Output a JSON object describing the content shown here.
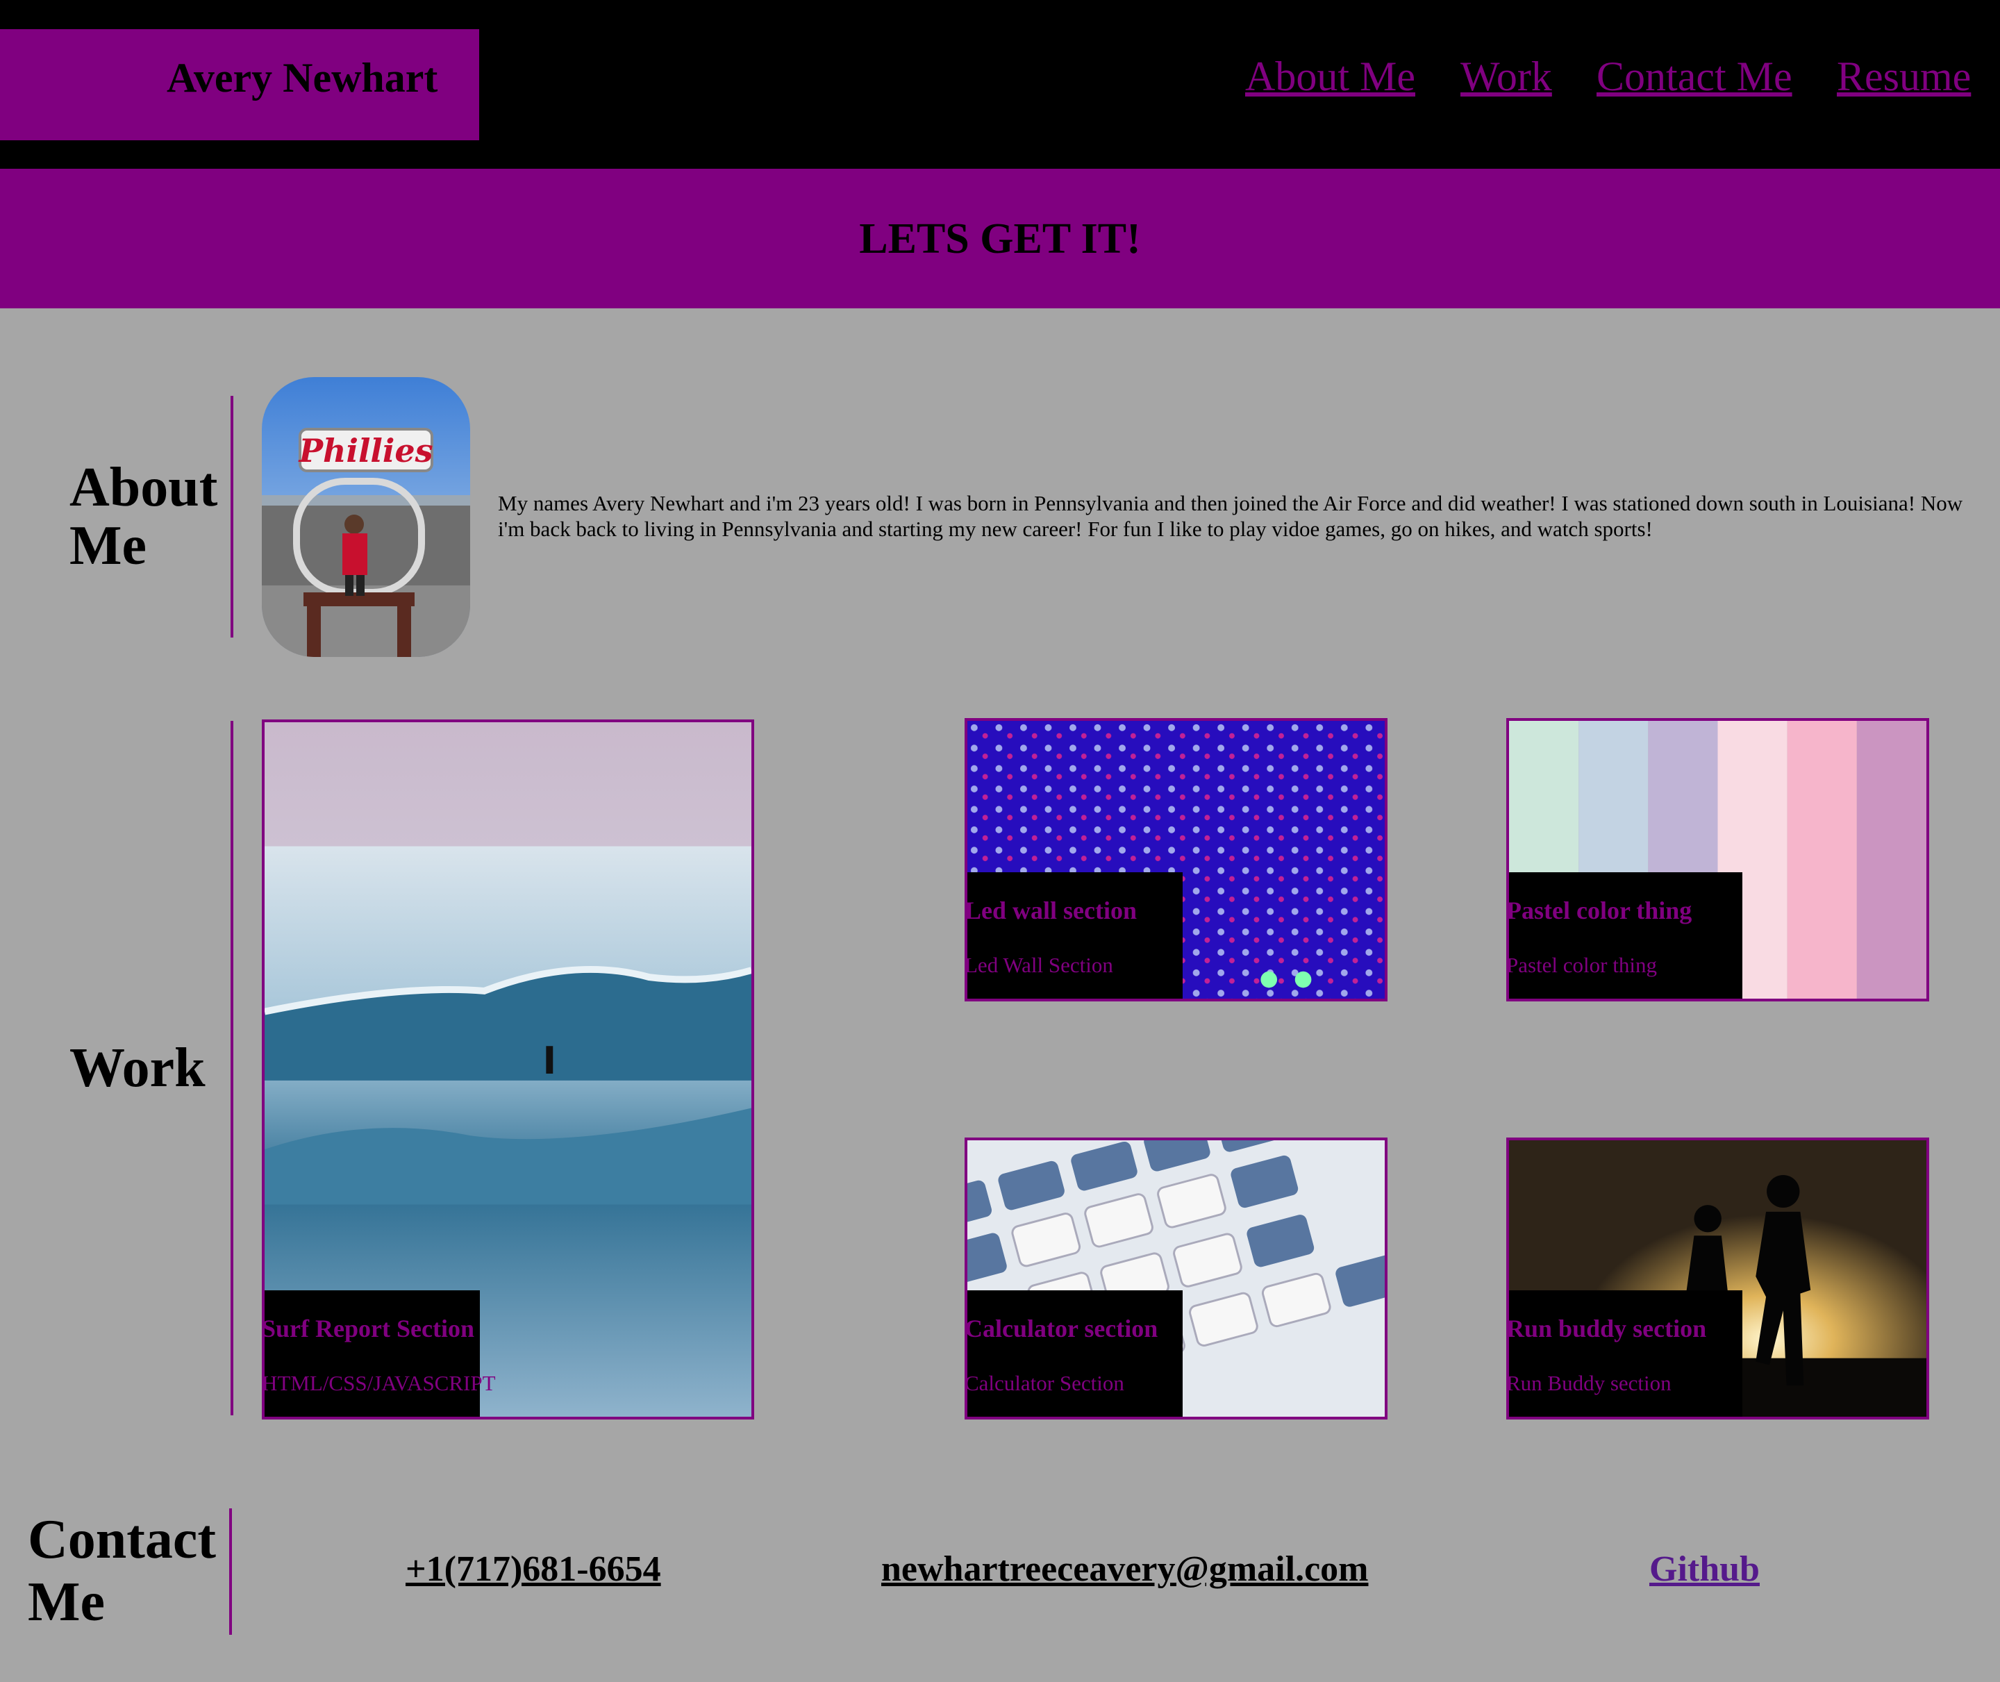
{
  "header": {
    "brand": "Avery Newhart",
    "nav": [
      "About Me",
      "Work",
      "Contact Me",
      "Resume"
    ]
  },
  "banner": {
    "text": "LETS GET IT!"
  },
  "about": {
    "title_line1": "About",
    "title_line2": "Me",
    "text": "My names Avery Newhart and i'm 23 years old! I was born in Pennsylvania and then joined the Air Force and did weather! I was stationed down south in Louisiana! Now i'm back back to living in Pennsylvania and starting my new career! For fun I like to play vidoe games, go on hikes, and watch sports!"
  },
  "work": {
    "title": "Work",
    "cards": [
      {
        "title": "Surf Report Section",
        "subtitle": "HTML/CSS/JAVASCRIPT"
      },
      {
        "title": "Led wall section",
        "subtitle": "Led Wall Section"
      },
      {
        "title": "Pastel color thing",
        "subtitle": "Pastel color thing"
      },
      {
        "title": "Calculator section",
        "subtitle": "Calculator Section"
      },
      {
        "title": "Run buddy section",
        "subtitle": "Run Buddy section"
      }
    ]
  },
  "contact": {
    "title_line1": "Contact",
    "title_line2": "Me",
    "phone": "+1(717)681-6654",
    "email": "newhartreeceavery@gmail.com",
    "github": "Github"
  },
  "colors": {
    "accent": "#800080",
    "background": "#a6a6a6",
    "header": "#000000",
    "link_visited": "#551a8b"
  }
}
